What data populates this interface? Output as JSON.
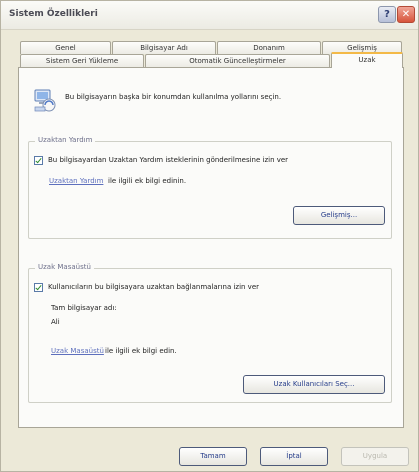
{
  "window": {
    "title": "Sistem Özellikleri",
    "help_glyph": "?",
    "close_glyph": "✕"
  },
  "tabs_row1": [
    "Genel",
    "Bilgisayar Adı",
    "Donanım",
    "Gelişmiş"
  ],
  "tabs_row2": [
    "Sistem Geri Yükleme",
    "Otomatik Güncelleştirmeler",
    "Uzak"
  ],
  "active_tab": "Uzak",
  "intro_text": "Bu bilgisayarın başka bir konumdan kullanılma yollarını seçin.",
  "remote_assistance": {
    "group_title": "Uzaktan Yardım",
    "checkbox_label": "Bu bilgisayardan Uzaktan Yardım isteklerinin gönderilmesine izin ver",
    "checked": true,
    "link_text": "Uzaktan Yardım",
    "link_suffix": "ile ilgili ek bilgi edinin.",
    "advanced_button": "Gelişmiş..."
  },
  "remote_desktop": {
    "group_title": "Uzak Masaüstü",
    "checkbox_label": "Kullanıcıların bu bilgisayara uzaktan bağlanmalarına izin ver",
    "checked": true,
    "computer_name_label": "Tam bilgisayar adı:",
    "computer_name_value": "Ali",
    "link_text": "Uzak Masaüstü",
    "link_suffix": "ile ilgili ek bilgi edin.",
    "select_users_button": "Uzak Kullanıcıları Seç..."
  },
  "footer": {
    "ok_button": "Tamam",
    "cancel_button": "İptal",
    "apply_button": "Uygula"
  }
}
